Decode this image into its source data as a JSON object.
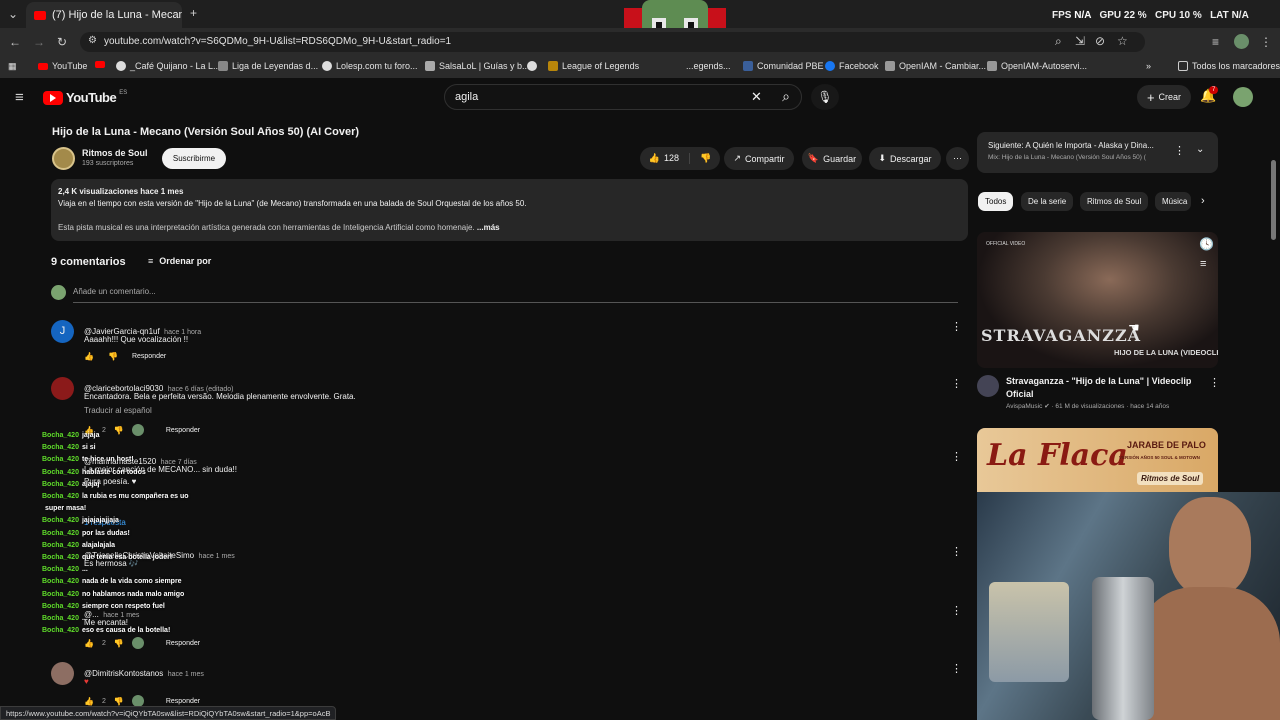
{
  "browser": {
    "tab_title": "(7) Hijo de la Luna - Mecan",
    "url": "youtube.com/watch?v=S6QDMo_9H-U&list=RDS6QDMo_9H-U&start_radio=1",
    "perf": {
      "fps_label": "FPS",
      "fps": "N/A",
      "gpu_label": "GPU",
      "gpu": "22 %",
      "cpu_label": "CPU",
      "cpu": "10 %",
      "lat_label": "LAT",
      "lat": "N/A"
    },
    "bookmarks": [
      "YouTube",
      "_Café Quijano - La L...",
      "Liga de Leyendas d...",
      "Lolesp.com tu foro...",
      "SalsaLoL | Guías y b...",
      "",
      "League of Legends",
      "...egends...",
      "Comunidad PBE",
      "Facebook",
      "OpenIAM - Cambiar...",
      "OpenIAM-Autoservi..."
    ],
    "all_bookmarks": "Todos los marcadores",
    "status_url": "https://www.youtube.com/watch?v=iQiQYbTA0sw&list=RDiQiQYbTA0sw&start_radio=1&pp=oAcB"
  },
  "yt": {
    "logo": "YouTube",
    "region": "ES",
    "search_value": "agila",
    "create": "Crear",
    "notif_count": "7"
  },
  "video": {
    "title": "Hijo de la Luna - Mecano (Versión Soul Años 50) (AI Cover)",
    "channel": "Ritmos de Soul",
    "subs": "193 suscriptores",
    "subscribe": "Suscribirme",
    "likes": "128",
    "share": "Compartir",
    "save": "Guardar",
    "download": "Descargar",
    "views_line": "2,4 K visualizaciones  hace 1 mes",
    "desc1": "Viaja en el tiempo con esta versión de \"Hijo de la Luna\" (de Mecano) transformada en una balada de Soul Orquestal de los años 50.",
    "desc2": "Esta pista musical es una interpretación artística generada con herramientas de Inteligencia Artificial como homenaje.",
    "more": "...más"
  },
  "comments": {
    "count": "9 comentarios",
    "sort": "Ordenar por",
    "add_placeholder": "Añade un comentario...",
    "reply": "Responder",
    "translate": "Traducir al español",
    "replies_link": "1 respuesta",
    "items": [
      {
        "user": "@JavierGarcia-qn1uf",
        "time": "hace 1 hora",
        "text": "Aaaahh!!!  Que vocalización !!",
        "likes": ""
      },
      {
        "user": "@claricebortolaci9030",
        "time": "hace 6 días (editado)",
        "text": "Encantadora. Bela e perfeita versão. Melodia plenamente envolvente. Grata.",
        "likes": "2"
      },
      {
        "user": "@marinamaste1520",
        "time": "hace 7 días",
        "text": "La mejor canción de MECANO... sin duda!!",
        "text2": "Pura poesía. ♥",
        "likes": "2"
      },
      {
        "user": "@TrianelleChristieVoltaiteSimo",
        "time": "hace 1 mes",
        "text": "Es hermosa 🎶",
        "likes": "2"
      },
      {
        "user": "@...",
        "time": "hace 1 mes",
        "text": "Me encanta!",
        "likes": "2"
      },
      {
        "user": "@DimitrisKontostanos",
        "time": "hace 1 mes",
        "text": "♥",
        "likes": "2"
      }
    ]
  },
  "chat": [
    {
      "u": "Bocha_420",
      "t": "jajaja"
    },
    {
      "u": "Bocha_420",
      "t": "si si"
    },
    {
      "u": "Bocha_420",
      "t": "te hice un host!"
    },
    {
      "u": "Bocha_420",
      "t": "hablaste con todos"
    },
    {
      "u": "Bocha_420",
      "t": "ajajaj"
    },
    {
      "u": "Bocha_420",
      "t": "la rubia es mu compañera es uo"
    },
    {
      "u": "",
      "t": "super masa!"
    },
    {
      "u": "Bocha_420",
      "t": "jajajajajjaja"
    },
    {
      "u": "Bocha_420",
      "t": "por las dudas!"
    },
    {
      "u": "Bocha_420",
      "t": "alajalajala"
    },
    {
      "u": "Bocha_420",
      "t": "que tenia esa botella joder!"
    },
    {
      "u": "Bocha_420",
      "t": "..."
    },
    {
      "u": "Bocha_420",
      "t": "nada de la vida como siempre"
    },
    {
      "u": "Bocha_420",
      "t": "no hablamos nada malo amigo"
    },
    {
      "u": "Bocha_420",
      "t": "siempre con respeto fuel"
    },
    {
      "u": "Bocha_420",
      "t": "..."
    },
    {
      "u": "Bocha_420",
      "t": "eso es causa de la botella!"
    }
  ],
  "sidebar": {
    "next_label": "Siguiente: A Quién le Importa - Alaska y Dina...",
    "mix_label": "Mix: Hijo de la Luna - Mecano (Versión Soul Años 50) (",
    "chips": [
      "Todos",
      "De la serie",
      "Ritmos de Soul",
      "Música"
    ],
    "rec1": {
      "title": "Stravaganzza - \"Hijo de la Luna\" | Videoclip Oficial",
      "channel": "AvispaMusic",
      "meta": "61 M de visualizaciones · hace 14 años",
      "thumb_brand": "STRAVAGANZZA",
      "thumb_sub": "HIJO DE LA LUNA (VIDEOCLIP)",
      "thumb_tag": "OFFICIAL VIDEO"
    },
    "rec2": {
      "thumb_title": "La Flaca",
      "thumb_artist": "JARABE DE PALO",
      "thumb_sub": "VERSIÓN AÑOS 50 SOUL & MOTOWN",
      "thumb_brand": "Ritmos de Soul"
    }
  },
  "colors": {
    "accent": "#ff0000",
    "chat_user": "#5fdd2a",
    "link": "#3ea6ff"
  }
}
